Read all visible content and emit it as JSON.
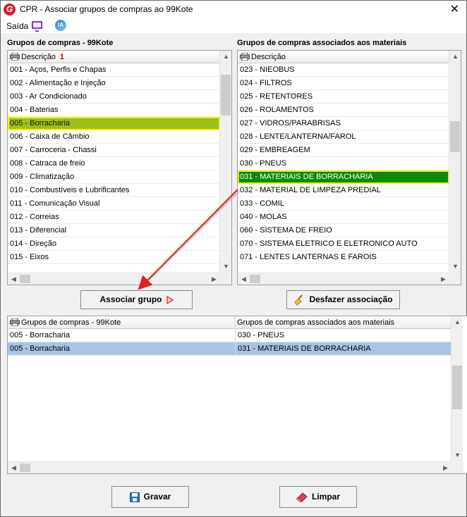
{
  "window": {
    "title": "CPR - Associar grupos de compras ao 99Kote",
    "close_glyph": "✕"
  },
  "menu": {
    "saida": "Saída",
    "ia_label": "IA"
  },
  "left_panel": {
    "label": "Grupos de compras - 99Kote",
    "header": "Descrição",
    "sort_indicator": "1",
    "rows": [
      "001 - Aços, Perfis e Chapas",
      "002 - Alimentação e Injeção",
      "003 - Ar Condicionado",
      "004 - Baterias",
      "005 - Borracharia",
      "006 - Caixa de Câmbio",
      "007 - Carroceria - Chassi",
      "008 - Catraca de freio",
      "009 - Climatização",
      "010 - Combustíveis e Lubrificantes",
      "011 - Comunicação Visual",
      "012 - Correias",
      "013 - Diferencial",
      "014 - Direção",
      "015 - Eixos"
    ],
    "selected_index": 4
  },
  "right_panel": {
    "label": "Grupos de compras associados aos materiais",
    "header": "Descrição",
    "rows": [
      "023 - NIEOBUS",
      "024 - FILTROS",
      "025 - RETENTORES",
      "026 - ROLAMENTOS",
      "027 - VIDROS/PARABRISAS",
      "028 - LENTE/LANTERNA/FAROL",
      "029 - EMBREAGEM",
      "030 - PNEUS",
      "031 - MATERIAIS DE BORRACHARIA",
      "032 - MATERIAL DE LIMPEZA PREDIAL",
      "033 - COMIL",
      "040 - MOLAS",
      "060 - SISTEMA DE FREIO",
      "070 - SISTEMA ELETRICO E ELETRONICO AUTO",
      "071 - LENTES LANTERNAS E FAROIS"
    ],
    "selected_index": 8
  },
  "buttons": {
    "associar": "Associar grupo",
    "desfazer": "Desfazer associação",
    "gravar": "Gravar",
    "limpar": "Limpar"
  },
  "bottom_grid": {
    "headers": [
      "Grupos de compras - 99Kote",
      "Grupos de compras associados aos materiais"
    ],
    "rows": [
      [
        "005 - Borracharia",
        "030 - PNEUS"
      ],
      [
        "005 - Borracharia",
        "031 - MATERIAIS DE BORRACHARIA"
      ]
    ],
    "selected_index": 1
  },
  "colors": {
    "yellow_green_selection": "#9cbf1a",
    "green_selection": "#0a8a0a",
    "blue_selection": "#a9c4e8",
    "arrow": "#e02020"
  }
}
